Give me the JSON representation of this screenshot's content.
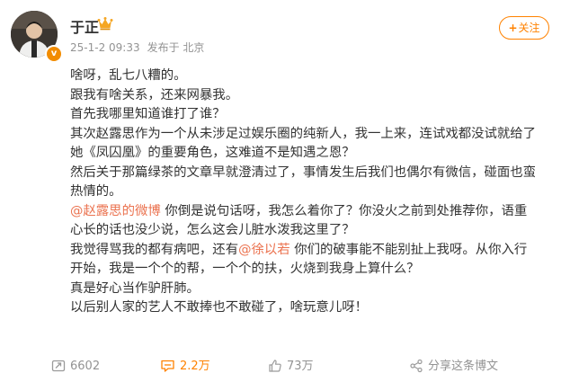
{
  "post": {
    "author": "于正",
    "timestamp": "25-1-2 09:33",
    "source": "发布于 北京",
    "follow_label": "关注",
    "follow_plus": "+",
    "verified_badge": "v",
    "icons": [
      "avatar-photo",
      "crown-icon",
      "verified-badge",
      "repost-icon",
      "comment-icon",
      "like-icon",
      "share-icon"
    ],
    "accent_color": "#ff8200",
    "mention_color": "#eb7350",
    "lines": [
      [
        {
          "t": "啥呀，乱七八糟的。"
        }
      ],
      [
        {
          "t": "跟我有啥关系，还来网暴我。"
        }
      ],
      [
        {
          "t": "首先我哪里知道谁打了谁？"
        }
      ],
      [
        {
          "t": "其次赵露思作为一个从未涉足过娱乐圈的纯新人，我一上来，连试戏都没试就给了"
        }
      ],
      [
        {
          "t": "她《凤囚凰》的重要角色，这难道不是知遇之恩？"
        }
      ],
      [
        {
          "t": "然后关于那篇绿茶的文章早就澄清过了，事情发生后我们也偶尔有微信，碰面也蛮"
        }
      ],
      [
        {
          "t": "热情的。"
        }
      ],
      [
        {
          "t": "@赵露思的微博",
          "m": true
        },
        {
          "t": " 你倒是说句话呀，我怎么着你了？你没火之前到处推荐你，语重"
        }
      ],
      [
        {
          "t": "心长的话也没少说，怎么这会儿脏水泼我这里了？"
        }
      ],
      [
        {
          "t": "我觉得骂我的都有病吧，还有"
        },
        {
          "t": "@徐以若",
          "m": true
        },
        {
          "t": " 你们的破事能不能别扯上我呀。从你入行"
        }
      ],
      [
        {
          "t": "开始，我是一个个的帮，一个个的扶，火烧到我身上算什么？"
        }
      ],
      [
        {
          "t": "真是好心当作驴肝肺。"
        }
      ],
      [
        {
          "t": "以后别人家的艺人不敢捧也不敢碰了，啥玩意儿呀！"
        }
      ]
    ]
  },
  "actions": {
    "repost": "6602",
    "comment": "2.2万",
    "like": "73万",
    "share": "分享这条博文"
  }
}
